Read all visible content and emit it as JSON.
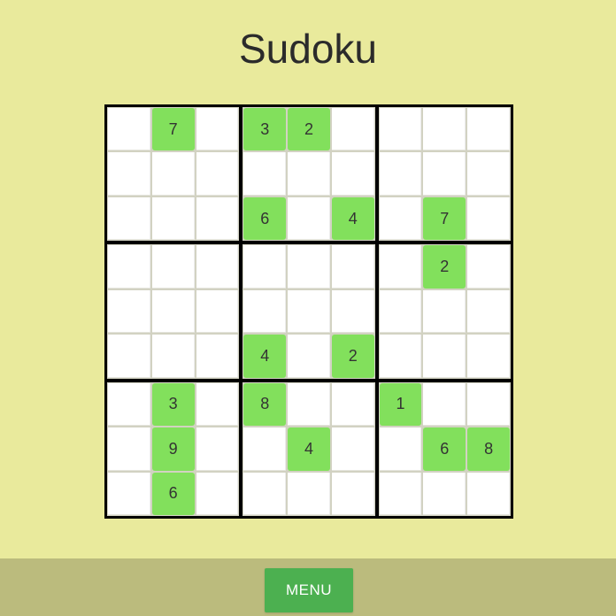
{
  "title": "Sudoku",
  "menu_label": "MENU",
  "colors": {
    "background": "#e9ea9c",
    "footer": "#bbbb7d",
    "given_cell": "#82e05c",
    "empty_cell": "#ffffff",
    "menu_button": "#4cb050"
  },
  "grid": [
    [
      "",
      "7",
      "",
      "3",
      "2",
      "",
      "",
      "",
      ""
    ],
    [
      "",
      "",
      "",
      "",
      "",
      "",
      "",
      "",
      ""
    ],
    [
      "",
      "",
      "",
      "6",
      "",
      "4",
      "",
      "7",
      ""
    ],
    [
      "",
      "",
      "",
      "",
      "",
      "",
      "",
      "2",
      ""
    ],
    [
      "",
      "",
      "",
      "",
      "",
      "",
      "",
      "",
      ""
    ],
    [
      "",
      "",
      "",
      "4",
      "",
      "2",
      "",
      "",
      ""
    ],
    [
      "",
      "3",
      "",
      "8",
      "",
      "",
      "1",
      "",
      ""
    ],
    [
      "",
      "9",
      "",
      "",
      "4",
      "",
      "",
      "6",
      "8"
    ],
    [
      "",
      "6",
      "",
      "",
      "",
      "",
      "",
      "",
      ""
    ]
  ]
}
